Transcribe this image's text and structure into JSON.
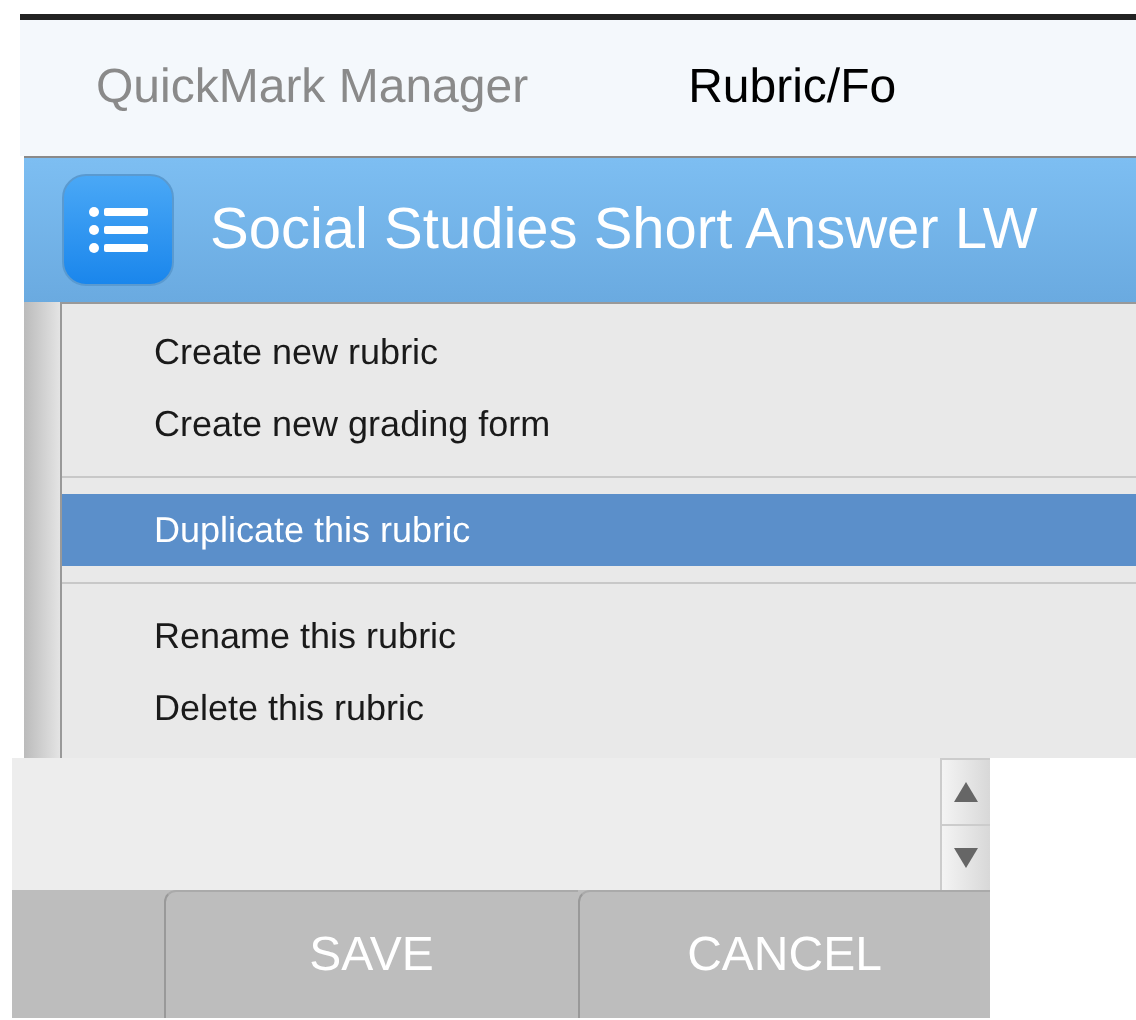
{
  "tabs": [
    {
      "label": "QuickMark Manager",
      "selected": false
    },
    {
      "label": "Rubric/Fo",
      "selected": true
    }
  ],
  "title_bar": {
    "title": "Social Studies Short Answer LW"
  },
  "menu": {
    "groups": [
      [
        {
          "label": "Create new rubric",
          "selected": false
        },
        {
          "label": "Create new grading form",
          "selected": false
        }
      ],
      [
        {
          "label": "Duplicate this rubric",
          "selected": true
        }
      ],
      [
        {
          "label": "Rename this rubric",
          "selected": false
        },
        {
          "label": "Delete this rubric",
          "selected": false
        }
      ]
    ]
  },
  "buttons": [
    "SAVE",
    "CANCEL"
  ]
}
